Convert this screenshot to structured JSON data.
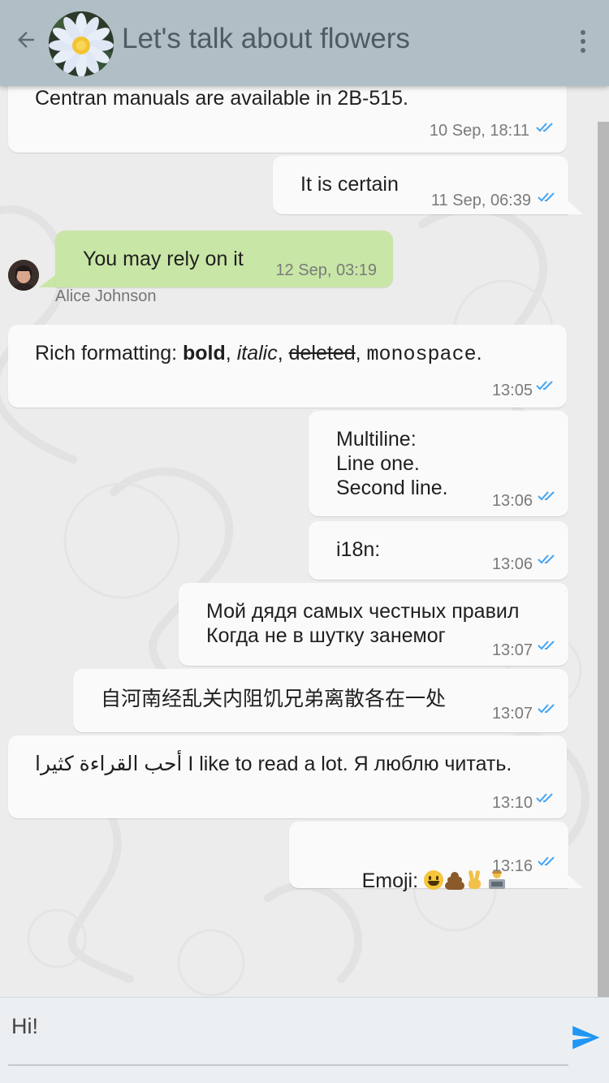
{
  "header": {
    "title": "Let's talk about flowers",
    "back_icon": "arrow-back-icon",
    "menu_icon": "more-vert-icon",
    "bg_color": "#b0bec5"
  },
  "messages": [
    {
      "text": "Centran manuals are available in 2B-515.",
      "time": "10 Sep, 18:11"
    },
    {
      "text": "It is certain",
      "time": "11 Sep, 06:39"
    },
    {
      "text": "You may rely on it",
      "time": "12 Sep, 03:19",
      "sender": "Alice Johnson"
    },
    {
      "prefix": "Rich formatting: ",
      "bold": "bold",
      "sep1": ", ",
      "italic": "italic",
      "sep2": ", ",
      "deleted": "deleted",
      "sep3": ", ",
      "mono": "monospace",
      "suffix": ".",
      "time": "13:05"
    },
    {
      "text": "Multiline:\nLine one.\nSecond line.",
      "time": "13:06"
    },
    {
      "text": "i18n:",
      "time": "13:06"
    },
    {
      "text": "Мой дядя самых честных правил\nКогда не в шутку занемог",
      "time": "13:07"
    },
    {
      "text": "自河南经乱关内阻饥兄弟离散各在一处",
      "time": "13:07"
    },
    {
      "text": "أحب القراءة كثيرا I like to read a lot. Я люблю читать.",
      "time": "13:10"
    },
    {
      "text": "Emoji: 😃💩✌️👨‍💻",
      "time": "13:16"
    }
  ],
  "composer": {
    "value": "Hi!",
    "send_icon": "send-icon"
  },
  "colors": {
    "incoming_bubble": "#fafafa",
    "outgoing_green": "#c8e6a6",
    "read_check": "#42a5f5",
    "send_accent": "#2196f3"
  }
}
